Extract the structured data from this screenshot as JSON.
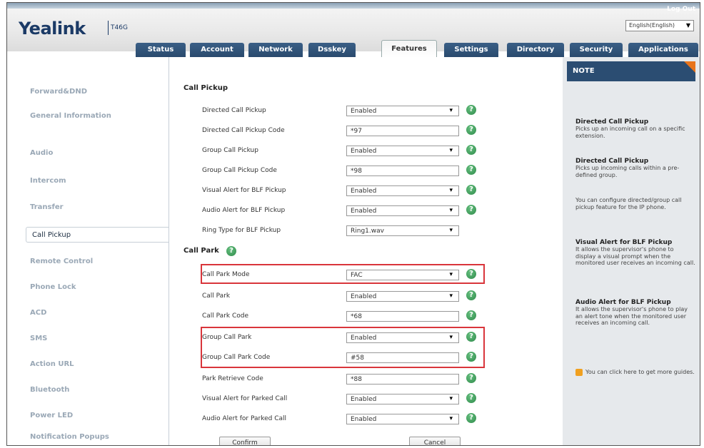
{
  "header": {
    "logo": "Yealink",
    "model": "T46G",
    "logout": "Log Out",
    "language": "English(English)"
  },
  "nav": {
    "tabs": [
      "Status",
      "Account",
      "Network",
      "Dsskey",
      "Features",
      "Settings",
      "Directory",
      "Security",
      "Applications"
    ],
    "active": "Features"
  },
  "sidebar": {
    "items": [
      "Forward&DND",
      "General Information",
      "Audio",
      "Intercom",
      "Transfer",
      "Call Pickup",
      "Remote Control",
      "Phone Lock",
      "ACD",
      "SMS",
      "Action URL",
      "Bluetooth",
      "Power LED",
      "Notification Popups"
    ],
    "active": "Call Pickup"
  },
  "main": {
    "call_pickup_title": "Call Pickup",
    "call_park_title": "Call Park",
    "rows": [
      {
        "label": "Directed Call Pickup",
        "value": "Enabled",
        "dropdown": true
      },
      {
        "label": "Directed Call Pickup Code",
        "value": "*97",
        "dropdown": false
      },
      {
        "label": "Group Call Pickup",
        "value": "Enabled",
        "dropdown": true
      },
      {
        "label": "Group Call Pickup Code",
        "value": "*98",
        "dropdown": false
      },
      {
        "label": "Visual Alert for BLF Pickup",
        "value": "Enabled",
        "dropdown": true
      },
      {
        "label": "Audio Alert for BLF Pickup",
        "value": "Enabled",
        "dropdown": true
      },
      {
        "label": "Ring Type for BLF Pickup",
        "value": "Ring1.wav",
        "dropdown": true
      },
      {
        "label": "Call Park Mode",
        "value": "FAC",
        "dropdown": true
      },
      {
        "label": "Call Park",
        "value": "Enabled",
        "dropdown": true
      },
      {
        "label": "Call Park Code",
        "value": "*68",
        "dropdown": false
      },
      {
        "label": "Group Call Park",
        "value": "Enabled",
        "dropdown": true
      },
      {
        "label": "Group Call Park Code",
        "value": "#58",
        "dropdown": false
      },
      {
        "label": "Park Retrieve Code",
        "value": "*88",
        "dropdown": false
      },
      {
        "label": "Visual Alert for Parked Call",
        "value": "Enabled",
        "dropdown": true
      },
      {
        "label": "Audio Alert for Parked Call",
        "value": "Enabled",
        "dropdown": true
      }
    ],
    "confirm": "Confirm",
    "cancel": "Cancel"
  },
  "note": {
    "title": "NOTE",
    "entries": [
      {
        "heading": "Directed Call Pickup",
        "text": "Picks up an incoming call on a specific extension."
      },
      {
        "heading": "Directed Call Pickup",
        "text": "Picks up incoming calls within a pre-defined group."
      },
      {
        "heading": "",
        "text": "You can configure directed/group call pickup feature for the IP phone."
      },
      {
        "heading": "Visual Alert for BLF Pickup",
        "text": "It allows the supervisor's phone to display a visual prompt when the monitored user receives an incoming call."
      },
      {
        "heading": "Audio Alert for BLF Pickup",
        "text": "It allows the supervisor's phone to play an alert tone when the monitored user receives an incoming call."
      }
    ],
    "guide": "You can click here to get more guides."
  },
  "colors": {
    "nav_tab": "#2a4a6e",
    "highlight": "#d9353b",
    "help_icon": "#2f8a4a",
    "note_header": "#2b4d72",
    "note_corner": "#e8741b"
  },
  "icons": [
    "help-icon",
    "dropdown-arrow-icon",
    "guide-icon"
  ]
}
